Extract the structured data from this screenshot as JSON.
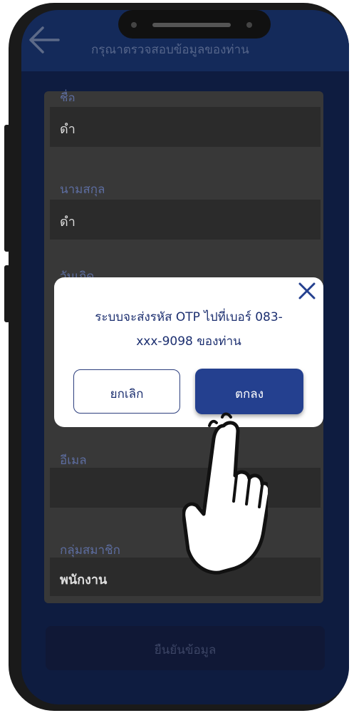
{
  "header": {
    "title": "กรุณาตรวจสอบข้อมูลของท่าน"
  },
  "form": {
    "fields": [
      {
        "label": "ชื่อ",
        "value": "ดำ"
      },
      {
        "label": "นามสกุล",
        "value": "ดำ"
      },
      {
        "label": "วันเกิด",
        "value": ""
      },
      {
        "label": "อีเมล",
        "value": ""
      },
      {
        "label": "กลุ่มสมาชิก",
        "value": "พนักงาน"
      }
    ],
    "confirm_label": "ยืนยันข้อมูล"
  },
  "dialog": {
    "message_line1": "ระบบจะส่งรหัส OTP ไปที่เบอร์ 083-",
    "message_line2": "xxx-9098 ของท่าน",
    "cancel_label": "ยกเลิก",
    "ok_label": "ตกลง"
  },
  "colors": {
    "accent": "#24408f",
    "header_bg": "#142a5a",
    "text_dark_blue": "#1c2f70"
  }
}
